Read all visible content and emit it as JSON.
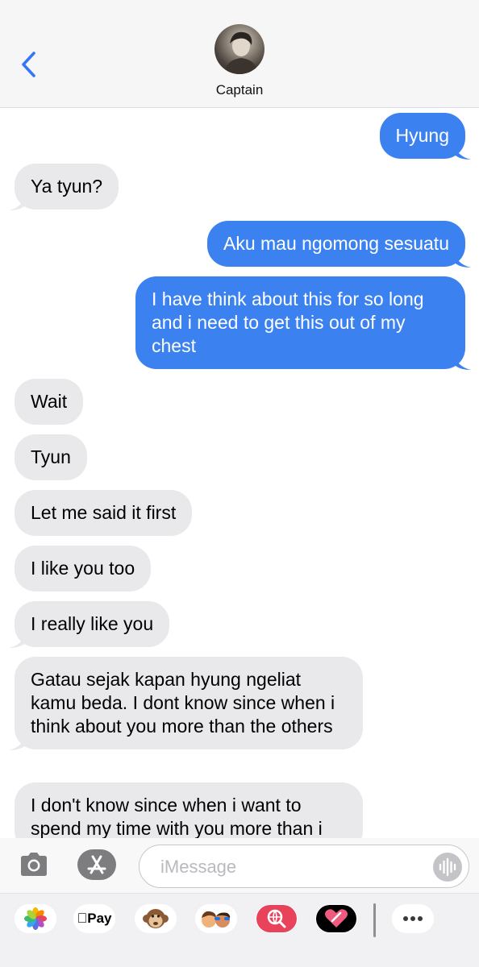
{
  "header": {
    "contact_name": "Captain"
  },
  "messages": [
    {
      "direction": "outgoing",
      "text": "Hyung"
    },
    {
      "direction": "incoming",
      "text": "Ya tyun?"
    },
    {
      "direction": "outgoing",
      "text": "Aku mau ngomong sesuatu"
    },
    {
      "direction": "outgoing",
      "text": "I have think about this for so long and i need to get this out of my chest"
    },
    {
      "direction": "incoming",
      "text": "Wait"
    },
    {
      "direction": "incoming",
      "text": "Tyun"
    },
    {
      "direction": "incoming",
      "text": "Let me said it first"
    },
    {
      "direction": "incoming",
      "text": "I like you too"
    },
    {
      "direction": "incoming",
      "text": "I really like you"
    },
    {
      "direction": "incoming",
      "text": "Gatau sejak kapan hyung ngeliat kamu beda. I dont know since when i think about you more than the others"
    },
    {
      "direction": "incoming",
      "text": "I don't know since when i want to spend my time with you more than i"
    }
  ],
  "composer": {
    "placeholder": "iMessage"
  },
  "app_drawer": {
    "apple_pay_label": "Pay",
    "apps": [
      "photos-app-icon",
      "apple-pay-app-icon",
      "animoji-app-icon",
      "memoji-app-icon",
      "web-search-app-icon",
      "digital-touch-app-icon",
      "more-apps-icon"
    ]
  },
  "colors": {
    "outgoing_bubble": "#3b82f0",
    "incoming_bubble": "#e9e9eb",
    "accent": "#3478f6"
  }
}
